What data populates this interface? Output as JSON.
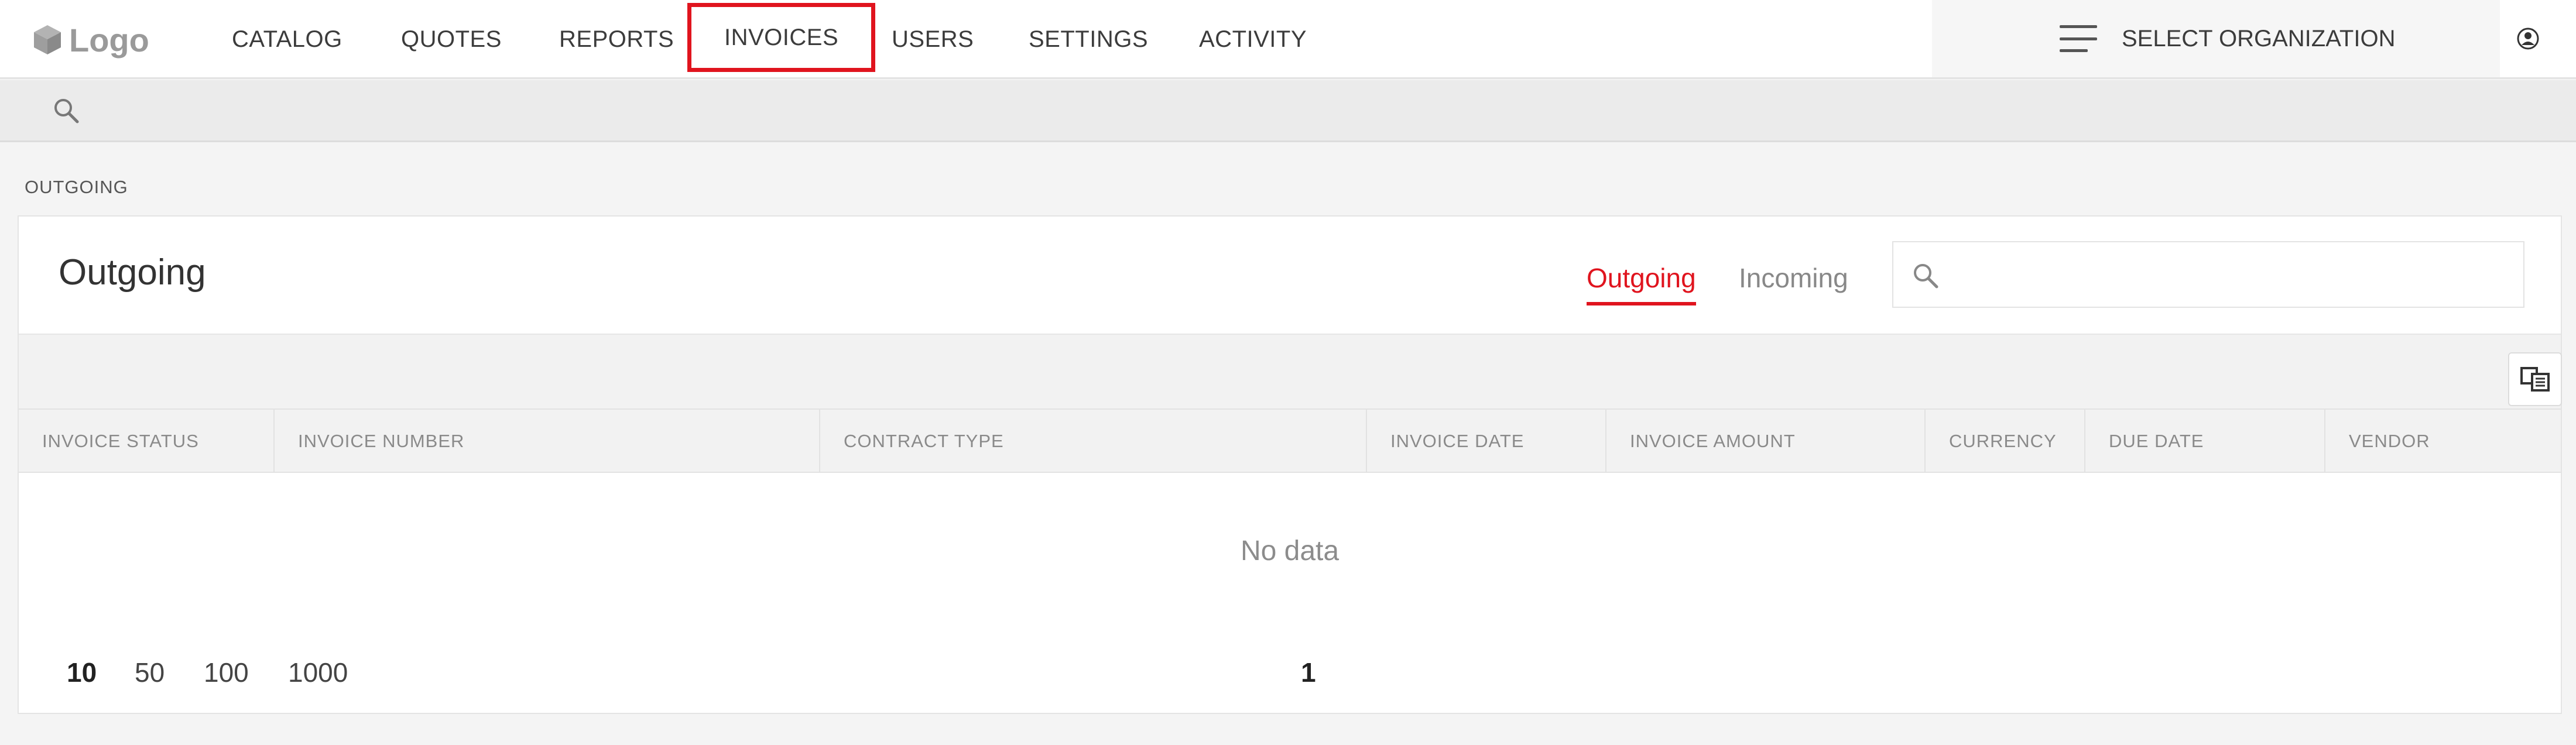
{
  "app": {
    "logo_text": "Logo"
  },
  "nav": {
    "items": [
      {
        "label": "CATALOG"
      },
      {
        "label": "QUOTES"
      },
      {
        "label": "REPORTS"
      },
      {
        "label": "INVOICES",
        "active": true
      },
      {
        "label": "USERS"
      },
      {
        "label": "SETTINGS"
      },
      {
        "label": "ACTIVITY"
      }
    ],
    "org_selector": "SELECT ORGANIZATION",
    "accent_color": "#e0141e"
  },
  "breadcrumb": "OUTGOING",
  "page": {
    "title": "Outgoing",
    "tabs": [
      {
        "label": "Outgoing",
        "active": true
      },
      {
        "label": "Incoming",
        "active": false
      }
    ],
    "search_placeholder": ""
  },
  "table": {
    "columns": [
      "INVOICE STATUS",
      "INVOICE NUMBER",
      "CONTRACT TYPE",
      "INVOICE DATE",
      "INVOICE AMOUNT",
      "CURRENCY",
      "DUE DATE",
      "VENDOR"
    ],
    "rows": [],
    "empty_text": "No data"
  },
  "pagination": {
    "page_sizes": [
      "10",
      "50",
      "100",
      "1000"
    ],
    "selected_page_size": "10",
    "current_page": "1"
  }
}
